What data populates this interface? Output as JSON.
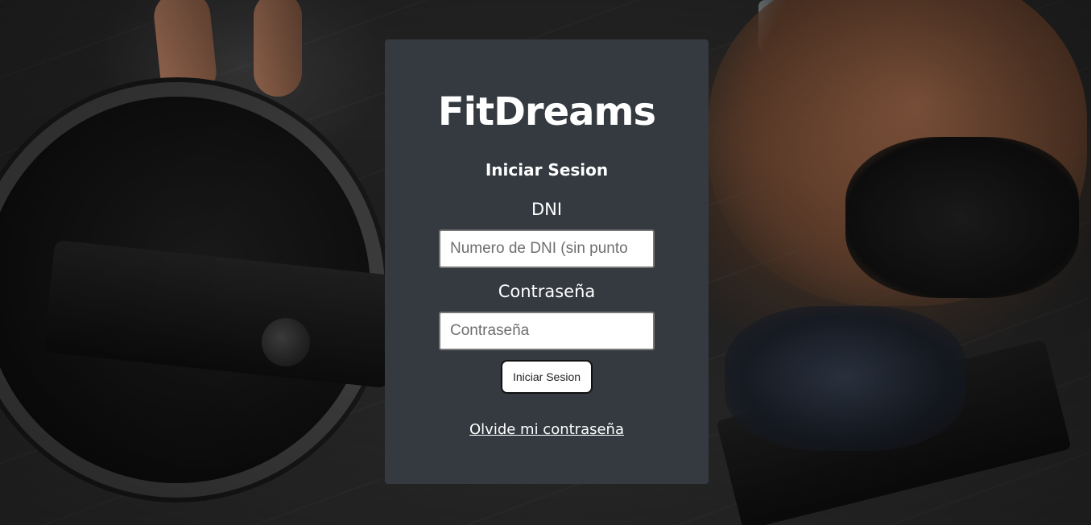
{
  "app": {
    "brand": "FitDreams"
  },
  "login": {
    "title": "Iniciar Sesion",
    "dni_label": "DNI",
    "dni_value": "",
    "dni_placeholder": "Numero de DNI (sin punto",
    "password_label": "Contraseña",
    "password_value": "",
    "password_placeholder": "Contraseña",
    "submit_label": "Iniciar Sesion",
    "forgot_link": "Olvide mi contraseña"
  },
  "colors": {
    "card_background": "#343a40",
    "text": "#ffffff",
    "input_background": "#ffffff"
  },
  "icons": {
    "background": "gym-rowing-machine-photo"
  }
}
